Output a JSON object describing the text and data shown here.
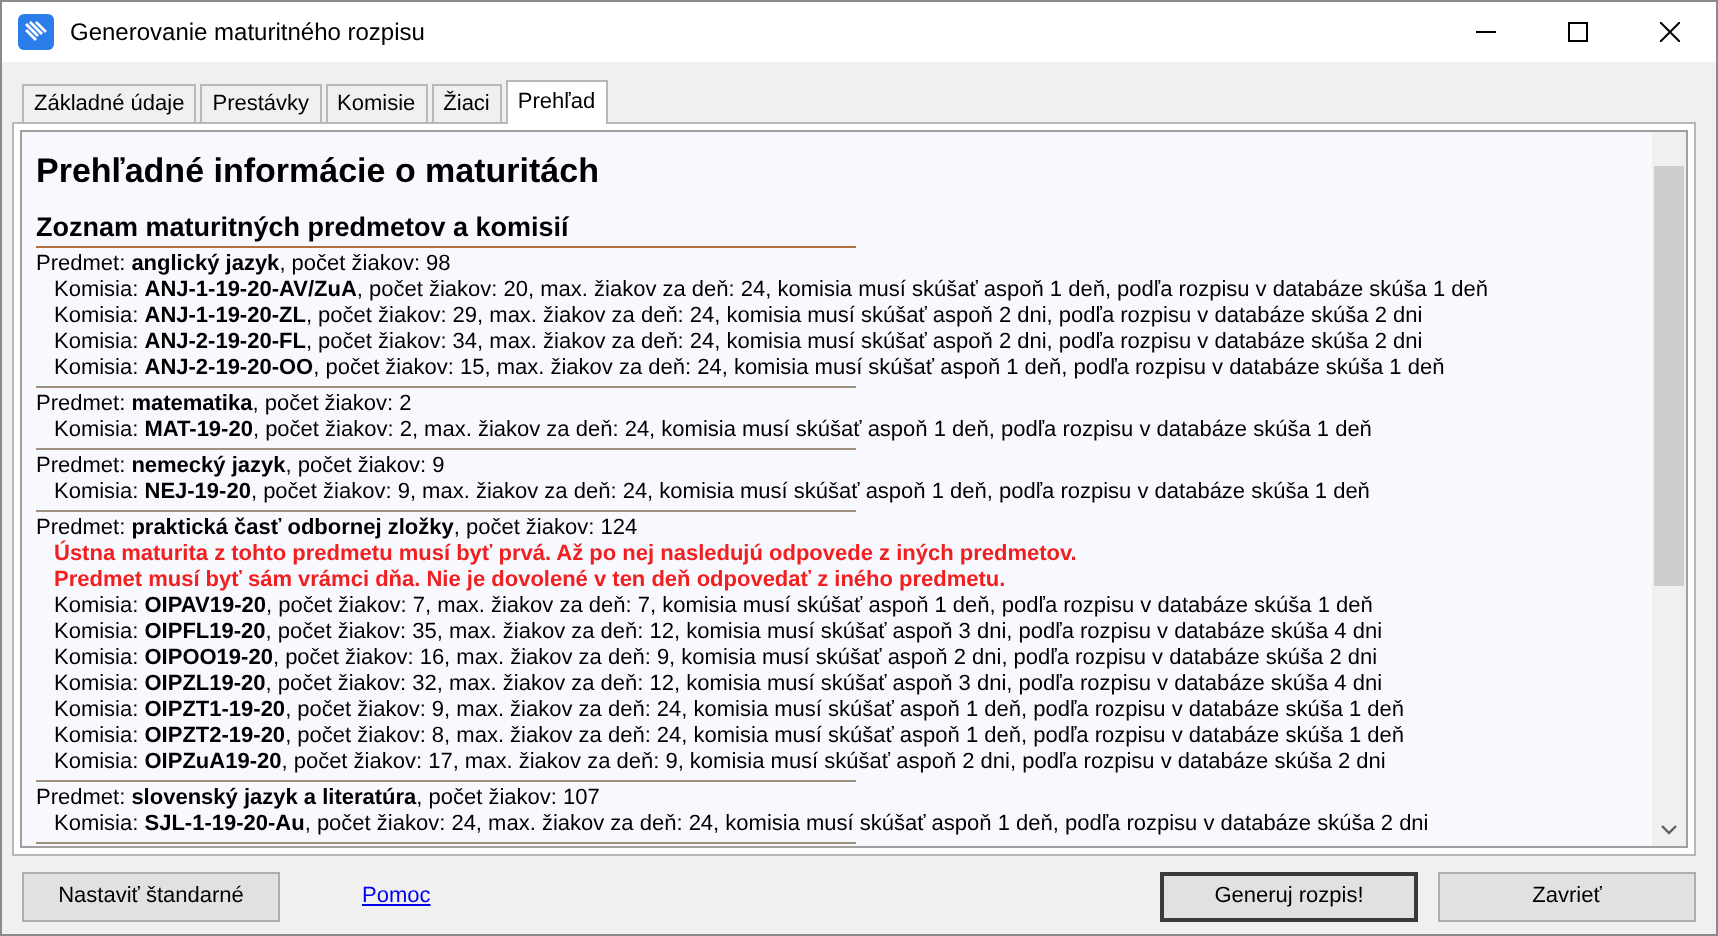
{
  "window": {
    "title": "Generovanie maturitného rozpisu"
  },
  "tabs": [
    {
      "label": "Základné údaje",
      "selected": false
    },
    {
      "label": "Prestávky",
      "selected": false
    },
    {
      "label": "Komisie",
      "selected": false
    },
    {
      "label": "Žiaci",
      "selected": false
    },
    {
      "label": "Prehľad",
      "selected": true
    }
  ],
  "report": {
    "title": "Prehľadné informácie o maturitách",
    "subtitle": "Zoznam maturitných predmetov a komisií",
    "subjects": [
      {
        "line": "Predmet: **anglický jazyk**, počet žiakov: 98",
        "commissions": [
          "Komisia: **ANJ-1-19-20-AV/ZuA**, počet žiakov: 20, max. žiakov za deň: 24, komisia musí skúšať aspoň 1 deň, podľa rozpisu v databáze skúša 1 deň",
          "Komisia: **ANJ-1-19-20-ZL**, počet žiakov: 29, max. žiakov za deň: 24, komisia musí skúšať aspoň 2 dni, podľa rozpisu v databáze skúša 2 dni",
          "Komisia: **ANJ-2-19-20-FL**, počet žiakov: 34, max. žiakov za deň: 24, komisia musí skúšať aspoň 2 dni, podľa rozpisu v databáze skúša 2 dni",
          "Komisia: **ANJ-2-19-20-OO**, počet žiakov: 15, max. žiakov za deň: 24, komisia musí skúšať aspoň 1 deň, podľa rozpisu v databáze skúša 1 deň"
        ]
      },
      {
        "line": "Predmet: **matematika**, počet žiakov: 2",
        "commissions": [
          "Komisia: **MAT-19-20**, počet žiakov: 2, max. žiakov za deň: 24, komisia musí skúšať aspoň 1 deň, podľa rozpisu v databáze skúša 1 deň"
        ]
      },
      {
        "line": "Predmet: **nemecký jazyk**, počet žiakov: 9",
        "commissions": [
          "Komisia: **NEJ-19-20**, počet žiakov: 9, max. žiakov za deň: 24, komisia musí skúšať aspoň 1 deň, podľa rozpisu v databáze skúša 1 deň"
        ]
      },
      {
        "line": "Predmet: **praktická časť odbornej zložky**, počet žiakov: 124",
        "warnings": [
          "Ústna maturita z tohto predmetu musí byť prvá. Až po nej nasledujú odpovede z iných predmetov.",
          "Predmet musí byť sám vrámci dňa. Nie je dovolené v ten deň odpovedať z iného predmetu."
        ],
        "commissions": [
          "Komisia: **OIPAV19-20**, počet žiakov: 7, max. žiakov za deň: 7, komisia musí skúšať aspoň 1 deň, podľa rozpisu v databáze skúša 1 deň",
          "Komisia: **OIPFL19-20**, počet žiakov: 35, max. žiakov za deň: 12, komisia musí skúšať aspoň 3 dni, podľa rozpisu v databáze skúša 4 dni",
          "Komisia: **OIPOO19-20**, počet žiakov: 16, max. žiakov za deň: 9, komisia musí skúšať aspoň 2 dni, podľa rozpisu v databáze skúša 2 dni",
          "Komisia: **OIPZL19-20**, počet žiakov: 32, max. žiakov za deň: 12, komisia musí skúšať aspoň 3 dni, podľa rozpisu v databáze skúša 4 dni",
          "Komisia: **OIPZT1-19-20**, počet žiakov: 9, max. žiakov za deň: 24, komisia musí skúšať aspoň 1 deň, podľa rozpisu v databáze skúša 1 deň",
          "Komisia: **OIPZT2-19-20**, počet žiakov: 8, max. žiakov za deň: 24, komisia musí skúšať aspoň 1 deň, podľa rozpisu v databáze skúša 1 deň",
          "Komisia: **OIPZuA19-20**, počet žiakov: 17, max. žiakov za deň: 9, komisia musí skúšať aspoň 2 dni, podľa rozpisu v databáze skúša 2 dni"
        ]
      },
      {
        "line": "Predmet: **slovenský jazyk a literatúra**, počet žiakov: 107",
        "commissions": [
          "Komisia: **SJL-1-19-20-Au**, počet žiakov: 24, max. žiakov za deň: 24, komisia musí skúšať aspoň 1 deň, podľa rozpisu v databáze skúša 2 dni"
        ]
      }
    ]
  },
  "footer": {
    "reset_button": "Nastaviť štandarné",
    "help_link": "Pomoc",
    "generate_button": "Generuj rozpis!",
    "close_button": "Zavrieť"
  }
}
